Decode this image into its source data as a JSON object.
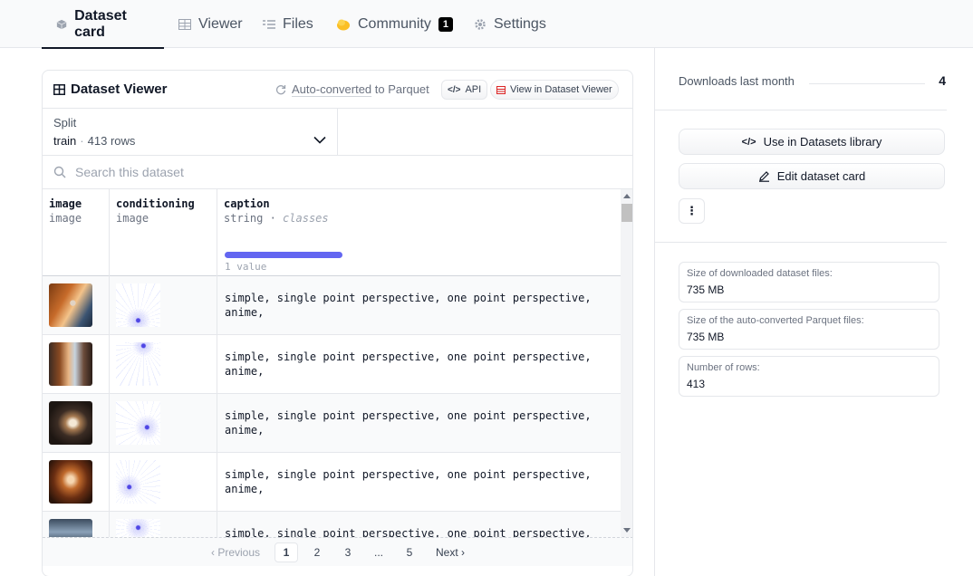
{
  "tabs": [
    {
      "label": "Dataset card",
      "icon": "cube-icon",
      "active": true
    },
    {
      "label": "Viewer",
      "icon": "table-icon"
    },
    {
      "label": "Files",
      "icon": "files-icon"
    },
    {
      "label": "Community",
      "icon": "community-icon",
      "badge": "1"
    },
    {
      "label": "Settings",
      "icon": "gear-icon"
    }
  ],
  "viewer": {
    "title": "Dataset Viewer",
    "auto_converted_link": "Auto-converted",
    "auto_converted_rest": " to Parquet",
    "api_label": "API",
    "view_label": "View in Dataset Viewer",
    "split": {
      "label": "Split",
      "value": "train",
      "rows": "413 rows"
    },
    "search_placeholder": "Search this dataset",
    "columns": [
      {
        "name": "image",
        "type": "image"
      },
      {
        "name": "conditioning",
        "type": "image"
      },
      {
        "name": "caption",
        "type": "string",
        "type_extra": "classes",
        "count": "1 value"
      }
    ],
    "rows": [
      {
        "caption": "simple, single point perspective, one point perspective,\nanime,"
      },
      {
        "caption": "simple, single point perspective, one point perspective,\nanime,"
      },
      {
        "caption": "simple, single point perspective, one point perspective,\nanime,"
      },
      {
        "caption": "simple, single point perspective, one point perspective,\nanime,"
      },
      {
        "caption": "simple, single point perspective, one point perspective,\nanime,"
      }
    ],
    "pagination": {
      "previous": "Previous",
      "pages": [
        "1",
        "2",
        "3",
        "...",
        "5"
      ],
      "current": "1",
      "next": "Next"
    }
  },
  "sidebar": {
    "downloads_label": "Downloads last month",
    "downloads_value": "4",
    "use_library_label": "Use in Datasets library",
    "edit_card_label": "Edit dataset card",
    "more_label": "⋮",
    "stats": [
      {
        "label": "Size of downloaded dataset files:",
        "value": "735 MB"
      },
      {
        "label": "Size of the auto-converted Parquet files:",
        "value": "735 MB"
      },
      {
        "label": "Number of rows:",
        "value": "413"
      }
    ]
  },
  "colors": {
    "accent_bar": "#6366f1",
    "community_icon": "#fbbf24",
    "view_button_icon": "#dc2626"
  }
}
